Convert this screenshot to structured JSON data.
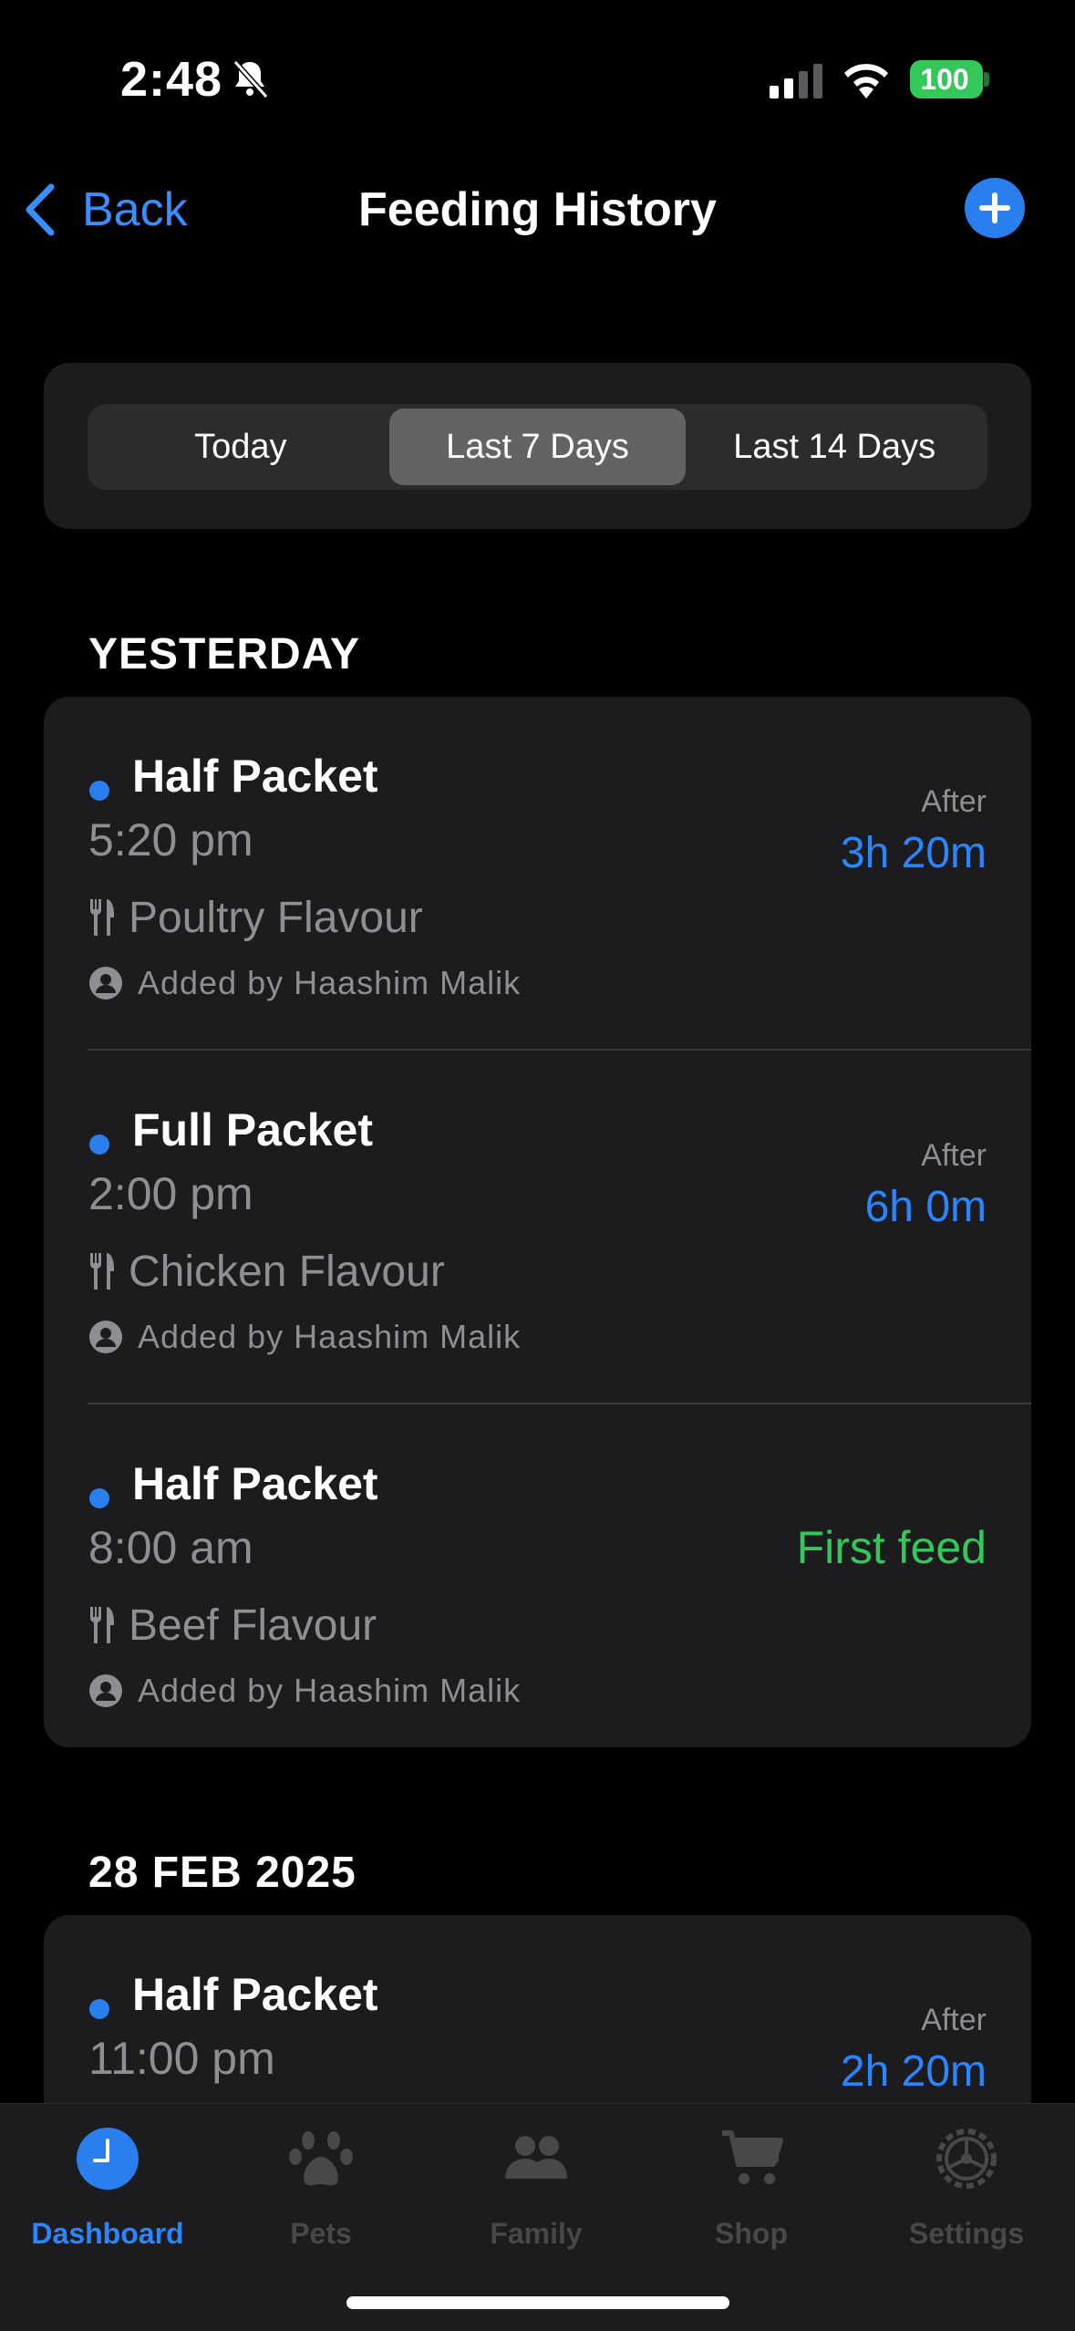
{
  "status": {
    "time": "2:48",
    "battery": "100"
  },
  "nav": {
    "back_label": "Back",
    "title": "Feeding History"
  },
  "segments": [
    "Today",
    "Last 7 Days",
    "Last 14 Days"
  ],
  "selected_segment": "Last 7 Days",
  "sections": [
    {
      "header": "YESTERDAY",
      "entries": [
        {
          "amount": "Half Packet",
          "time": "5:20 pm",
          "food": "Poultry Flavour",
          "added_by": "Added by Haashim Malik",
          "after_label": "After",
          "after_value": "3h 20m"
        },
        {
          "amount": "Full Packet",
          "time": "2:00 pm",
          "food": "Chicken Flavour",
          "added_by": "Added by Haashim Malik",
          "after_label": "After",
          "after_value": "6h 0m"
        },
        {
          "amount": "Half Packet",
          "time": "8:00 am",
          "food": "Beef Flavour",
          "added_by": "Added by Haashim Malik",
          "first_feed": "First feed"
        }
      ]
    },
    {
      "header": "28 FEB 2025",
      "entries": [
        {
          "amount": "Half Packet",
          "time": "11:00 pm",
          "after_label": "After",
          "after_value": "2h 20m"
        }
      ]
    }
  ],
  "tabs": [
    "Dashboard",
    "Pets",
    "Family",
    "Shop",
    "Settings"
  ],
  "active_tab": "Dashboard",
  "colors": {
    "accent": "#2a7fef",
    "green": "#34c759",
    "card": "#1c1c1e"
  }
}
